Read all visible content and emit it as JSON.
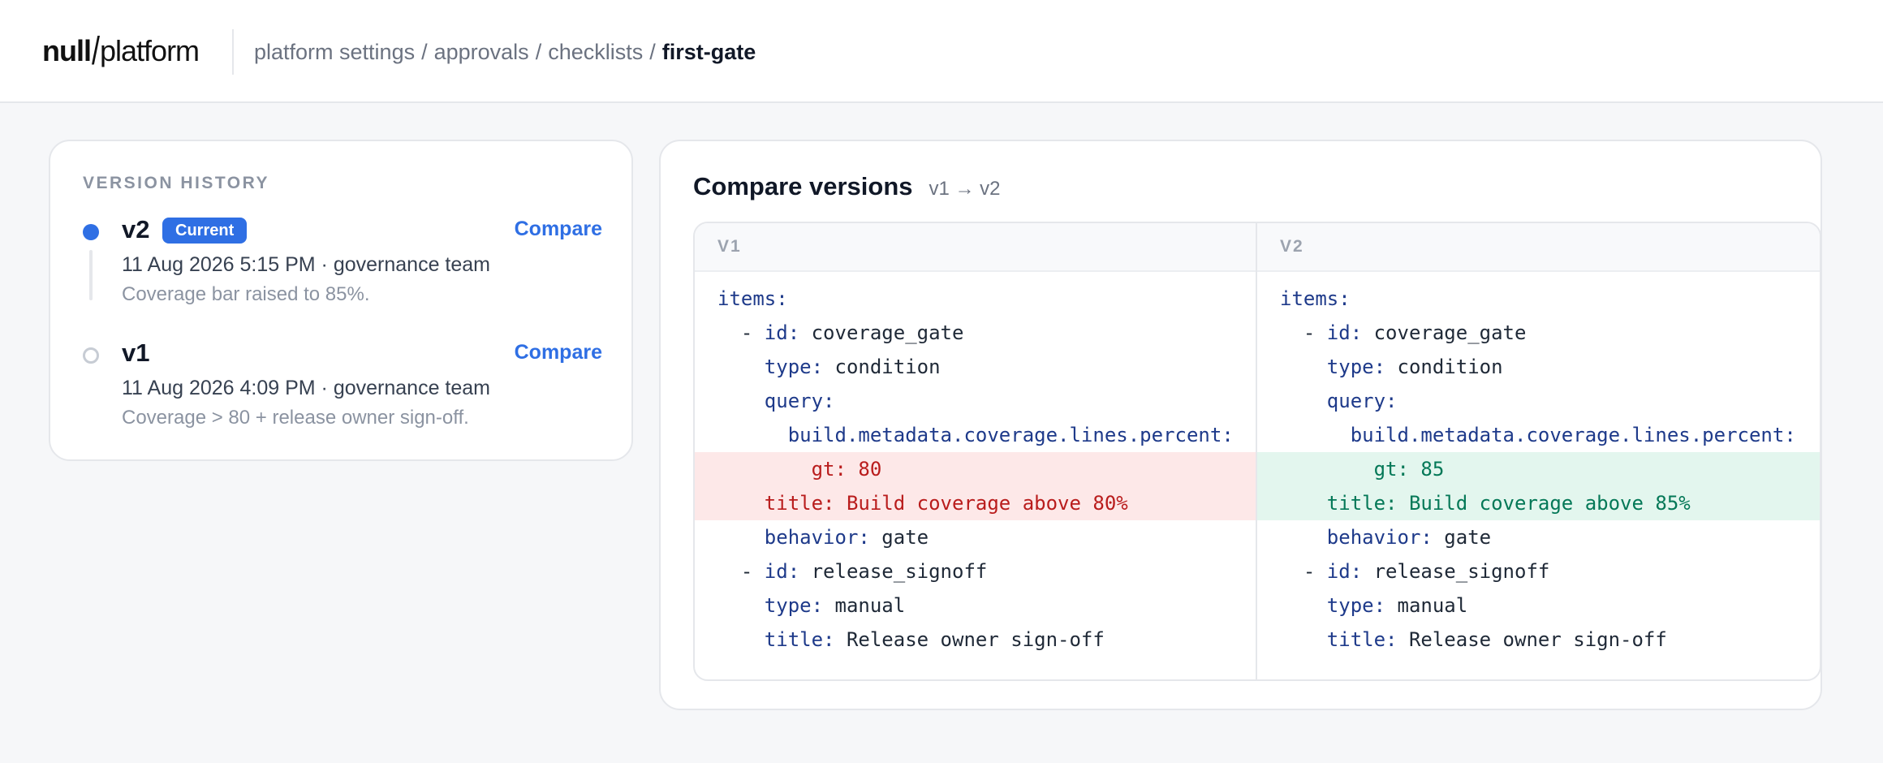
{
  "header": {
    "logo_bold": "null",
    "logo_light": "platform",
    "breadcrumb": [
      "platform settings",
      "approvals",
      "checklists"
    ],
    "breadcrumb_current": "first-gate",
    "separator": "/"
  },
  "history": {
    "title": "VERSION HISTORY",
    "versions": [
      {
        "name": "v2",
        "badge": "Current",
        "meta": "11 Aug 2026 5:15 PM · governance team",
        "note": "Coverage bar raised to 85%.",
        "action": "Compare"
      },
      {
        "name": "v1",
        "badge": "",
        "meta": "11 Aug 2026 4:09 PM · governance team",
        "note": "Coverage > 80 + release owner sign-off.",
        "action": "Compare"
      }
    ]
  },
  "compare": {
    "title": "Compare versions",
    "subtitle": "v1 → v2",
    "left_header": "V1",
    "right_header": "V2",
    "left_lines": [
      {
        "indent": "",
        "key": "items:",
        "val": "",
        "type": "normal"
      },
      {
        "indent": "  - ",
        "key": "id:",
        "val": " coverage_gate",
        "type": "normal"
      },
      {
        "indent": "    ",
        "key": "type:",
        "val": " condition",
        "type": "normal"
      },
      {
        "indent": "    ",
        "key": "query:",
        "val": "",
        "type": "normal"
      },
      {
        "indent": "      ",
        "key": "build.metadata.coverage.lines.percent:",
        "val": "",
        "type": "normal"
      },
      {
        "indent": "        ",
        "key": "gt:",
        "val": " 80",
        "type": "del"
      },
      {
        "indent": "    ",
        "key": "title:",
        "val": " Build coverage above 80%",
        "type": "del"
      },
      {
        "indent": "    ",
        "key": "behavior:",
        "val": " gate",
        "type": "normal"
      },
      {
        "indent": "  - ",
        "key": "id:",
        "val": " release_signoff",
        "type": "normal"
      },
      {
        "indent": "    ",
        "key": "type:",
        "val": " manual",
        "type": "normal"
      },
      {
        "indent": "    ",
        "key": "title:",
        "val": " Release owner sign-off",
        "type": "normal"
      }
    ],
    "right_lines": [
      {
        "indent": "",
        "key": "items:",
        "val": "",
        "type": "normal"
      },
      {
        "indent": "  - ",
        "key": "id:",
        "val": " coverage_gate",
        "type": "normal"
      },
      {
        "indent": "    ",
        "key": "type:",
        "val": " condition",
        "type": "normal"
      },
      {
        "indent": "    ",
        "key": "query:",
        "val": "",
        "type": "normal"
      },
      {
        "indent": "      ",
        "key": "build.metadata.coverage.lines.percent:",
        "val": "",
        "type": "normal"
      },
      {
        "indent": "        ",
        "key": "gt:",
        "val": " 85",
        "type": "add"
      },
      {
        "indent": "    ",
        "key": "title:",
        "val": " Build coverage above 85%",
        "type": "add"
      },
      {
        "indent": "    ",
        "key": "behavior:",
        "val": " gate",
        "type": "normal"
      },
      {
        "indent": "  - ",
        "key": "id:",
        "val": " release_signoff",
        "type": "normal"
      },
      {
        "indent": "    ",
        "key": "type:",
        "val": " manual",
        "type": "normal"
      },
      {
        "indent": "    ",
        "key": "title:",
        "val": " Release owner sign-off",
        "type": "normal"
      }
    ]
  },
  "colors": {
    "accent": "#2f6fe4",
    "deleted_bg": "#fde8e8",
    "added_bg": "#e3f6ee"
  }
}
